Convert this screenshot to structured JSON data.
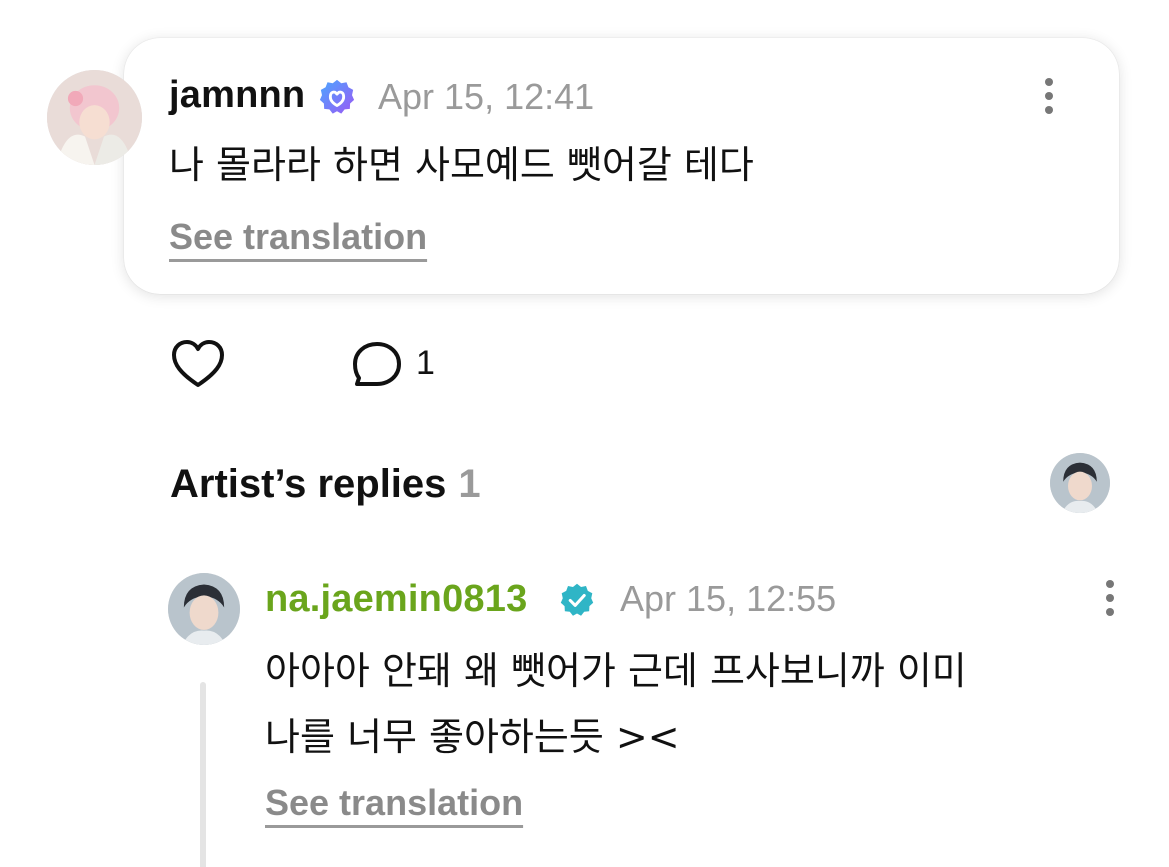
{
  "comment": {
    "username": "jamnnn",
    "timestamp": "Apr 15, 12:41",
    "text": "나 몰라라 하면 사모예드 뺏어갈 테다",
    "see_translation": "See translation"
  },
  "actions": {
    "reply_count": "1"
  },
  "artist_replies": {
    "title": "Artist’s replies",
    "count": "1"
  },
  "reply": {
    "username": "na.jaemin0813",
    "timestamp": "Apr 15, 12:55",
    "text_line1": "아아아 안돼 왜 뺏어가 근데 프사보니까 이미",
    "text_line2": "나를 너무 좋아하는듯 ><",
    "see_translation": "See translation"
  },
  "colors": {
    "artist_name": "#6aa51c",
    "fan_badge": "#7b6cf6",
    "artist_badge": "#2fb5c6",
    "muted": "#9a9a9a"
  },
  "icons": [
    "verified-badge-icon",
    "more-options-icon",
    "heart-icon",
    "comment-bubble-icon"
  ]
}
